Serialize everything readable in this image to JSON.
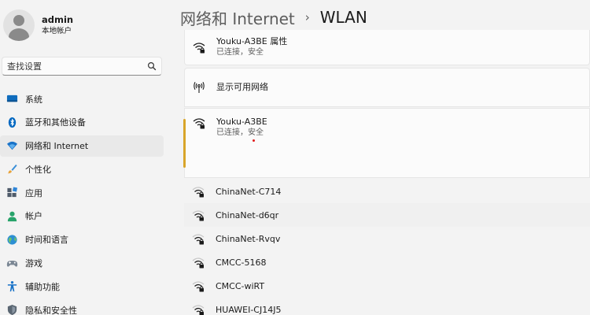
{
  "user": {
    "name": "admin",
    "subtitle": "本地帐户"
  },
  "search": {
    "placeholder": "查找设置"
  },
  "nav": [
    {
      "label": "系统",
      "icon": "system-icon",
      "active": false
    },
    {
      "label": "蓝牙和其他设备",
      "icon": "bluetooth-icon",
      "active": false
    },
    {
      "label": "网络和 Internet",
      "icon": "network-icon",
      "active": true
    },
    {
      "label": "个性化",
      "icon": "brush-icon",
      "active": false
    },
    {
      "label": "应用",
      "icon": "apps-icon",
      "active": false
    },
    {
      "label": "帐户",
      "icon": "account-icon",
      "active": false
    },
    {
      "label": "时间和语言",
      "icon": "globe-icon",
      "active": false
    },
    {
      "label": "游戏",
      "icon": "gamepad-icon",
      "active": false
    },
    {
      "label": "辅助功能",
      "icon": "accessibility-icon",
      "active": false
    },
    {
      "label": "隐私和安全性",
      "icon": "shield-icon",
      "active": false
    }
  ],
  "breadcrumb": {
    "parent": "网络和 Internet",
    "separator": "›",
    "current": "WLAN"
  },
  "properties": {
    "title": "Youku-A3BE 属性",
    "status": "已连接，安全"
  },
  "show_networks": {
    "label": "显示可用网络"
  },
  "connected": {
    "name": "Youku-A3BE",
    "status": "已连接，安全"
  },
  "networks": [
    {
      "name": "ChinaNet-C714"
    },
    {
      "name": "ChinaNet-d6qr"
    },
    {
      "name": "ChinaNet-Rvqv"
    },
    {
      "name": "CMCC-5168"
    },
    {
      "name": "CMCC-wiRT"
    },
    {
      "name": "HUAWEI-CJ14J5"
    }
  ],
  "colors": {
    "accent": "#d9a52a",
    "blue": "#0067c0",
    "active_bg": "#e9e9e9"
  }
}
